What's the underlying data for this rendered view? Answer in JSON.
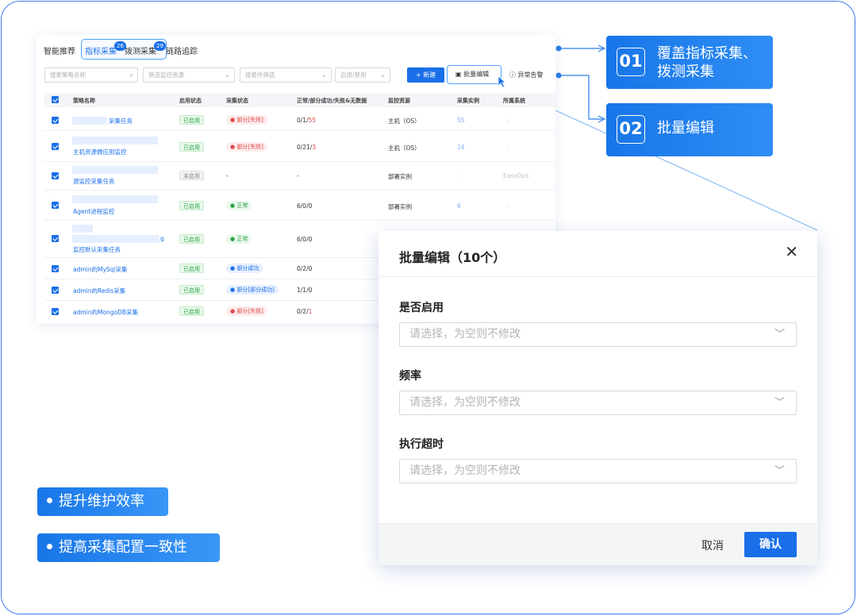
{
  "tabs": [
    {
      "label": "智能推荐",
      "badge": ""
    },
    {
      "label": "指标采集",
      "badge": "26"
    },
    {
      "label": "拨测采集",
      "badge": "29"
    },
    {
      "label": "链路追踪",
      "badge": ""
    }
  ],
  "filters": {
    "search_placeholder": "搜索策略名称",
    "resource_placeholder": "筛选监控资源",
    "package_placeholder": "按套件筛选",
    "status_placeholder": "启用/禁用",
    "new_label": "+ 新建",
    "batch_edit_label": "批量编辑",
    "alert_label": "异常告警"
  },
  "table": {
    "headers": [
      "策略名称",
      "启用状态",
      "采集状态",
      "正常/部分成功/失败&无数据",
      "监控资源",
      "采集实例",
      "所属系统"
    ],
    "rows": [
      {
        "name": "采集任务",
        "enabled": "已启用",
        "state": "部分[失败]",
        "state_type": "fail",
        "counts_a": "0/1/",
        "counts_b": "55",
        "resource": "主机（OS）",
        "instances": "55",
        "system": "-"
      },
      {
        "name": "主机资源微应用监控",
        "enabled": "已启用",
        "state": "部分[失败]",
        "state_type": "fail",
        "counts_a": "0/21/",
        "counts_b": "3",
        "resource": "主机（OS）",
        "instances": "24",
        "system": "-"
      },
      {
        "name": "源监控采集任务",
        "enabled": "未启用",
        "state": "-",
        "state_type": "none",
        "counts_a": "-",
        "counts_b": "",
        "resource": "部署实例",
        "instances": "-",
        "system": "EasyOps"
      },
      {
        "name": "Agent进程监控",
        "enabled": "已启用",
        "state": "正常",
        "state_type": "ok",
        "counts_a": "6/0/0",
        "counts_b": "",
        "resource": "部署实例",
        "instances": "6",
        "system": "-"
      },
      {
        "name": "监控默认采集任务",
        "name_prefix": "g",
        "enabled": "已启用",
        "state": "正常",
        "state_type": "ok",
        "counts_a": "6/0/0",
        "counts_b": "",
        "resource": "",
        "instances": "",
        "system": ""
      },
      {
        "name": "admin的MySql采集",
        "enabled": "已启用",
        "state": "部分成功",
        "state_type": "part",
        "counts_a": "0/2/0",
        "counts_b": "",
        "resource": "",
        "instances": "",
        "system": ""
      },
      {
        "name": "admin的Redis采集",
        "enabled": "已启用",
        "state": "部分[部分成功]",
        "state_type": "part",
        "counts_a": "1/1/0",
        "counts_b": "",
        "resource": "",
        "instances": "",
        "system": ""
      },
      {
        "name": "admin的MongoDB采集",
        "enabled": "已启用",
        "state": "部分[失败]",
        "state_type": "fail",
        "counts_a": "0/2/",
        "counts_b": "1",
        "resource": "",
        "instances": "",
        "system": ""
      }
    ]
  },
  "callouts": [
    {
      "num": "01",
      "line1": "覆盖指标采集、",
      "line2": "拨测采集"
    },
    {
      "num": "02",
      "line1": "批量编辑",
      "line2": ""
    }
  ],
  "highlights": [
    "提升维护效率",
    "提高采集配置一致性"
  ],
  "modal": {
    "title": "批量编辑（10个）",
    "fields": [
      {
        "label": "是否启用",
        "placeholder": "请选择，为空则不修改"
      },
      {
        "label": "频率",
        "placeholder": "请选择，为空则不修改"
      },
      {
        "label": "执行超时",
        "placeholder": "请选择，为空则不修改"
      }
    ],
    "cancel": "取消",
    "confirm": "确认"
  },
  "colors": {
    "accent": "#1a6fe8",
    "success": "#2aa64a",
    "danger": "#e04848"
  }
}
